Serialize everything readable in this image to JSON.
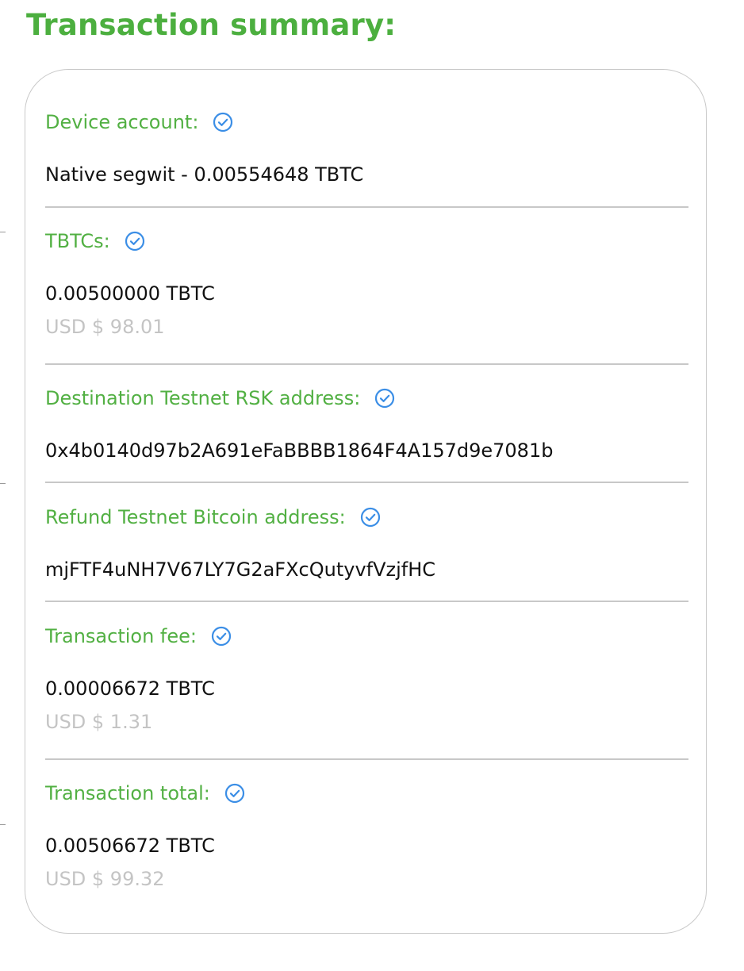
{
  "page_title": "Transaction summary:",
  "colors": {
    "title_green": "#4caf3f",
    "label_green": "#52b043",
    "check_blue": "#3b8ee6",
    "usd_gray": "#c4c4c4",
    "divider_gray": "#c8c8c8"
  },
  "summary": {
    "device_account": {
      "label": "Device account:",
      "icon": "check-circle-icon",
      "value": "Native segwit - 0.00554648 TBTC"
    },
    "tbtcs": {
      "label": "TBTCs:",
      "icon": "check-circle-icon",
      "value": "0.00500000 TBTC",
      "usd": "USD $ 98.01"
    },
    "destination": {
      "label": "Destination Testnet RSK address:",
      "icon": "check-circle-icon",
      "value": "0x4b0140d97b2A691eFaBBBB1864F4A157d9e7081b"
    },
    "refund": {
      "label": "Refund Testnet Bitcoin address:",
      "icon": "check-circle-icon",
      "value": "mjFTF4uNH7V67LY7G2aFXcQutyvfVzjfHC"
    },
    "fee": {
      "label": "Transaction fee:",
      "icon": "check-circle-icon",
      "value": "0.00006672 TBTC",
      "usd": "USD $ 1.31"
    },
    "total": {
      "label": "Transaction total:",
      "icon": "check-circle-icon",
      "value": "0.00506672 TBTC",
      "usd": "USD $ 99.32"
    }
  }
}
